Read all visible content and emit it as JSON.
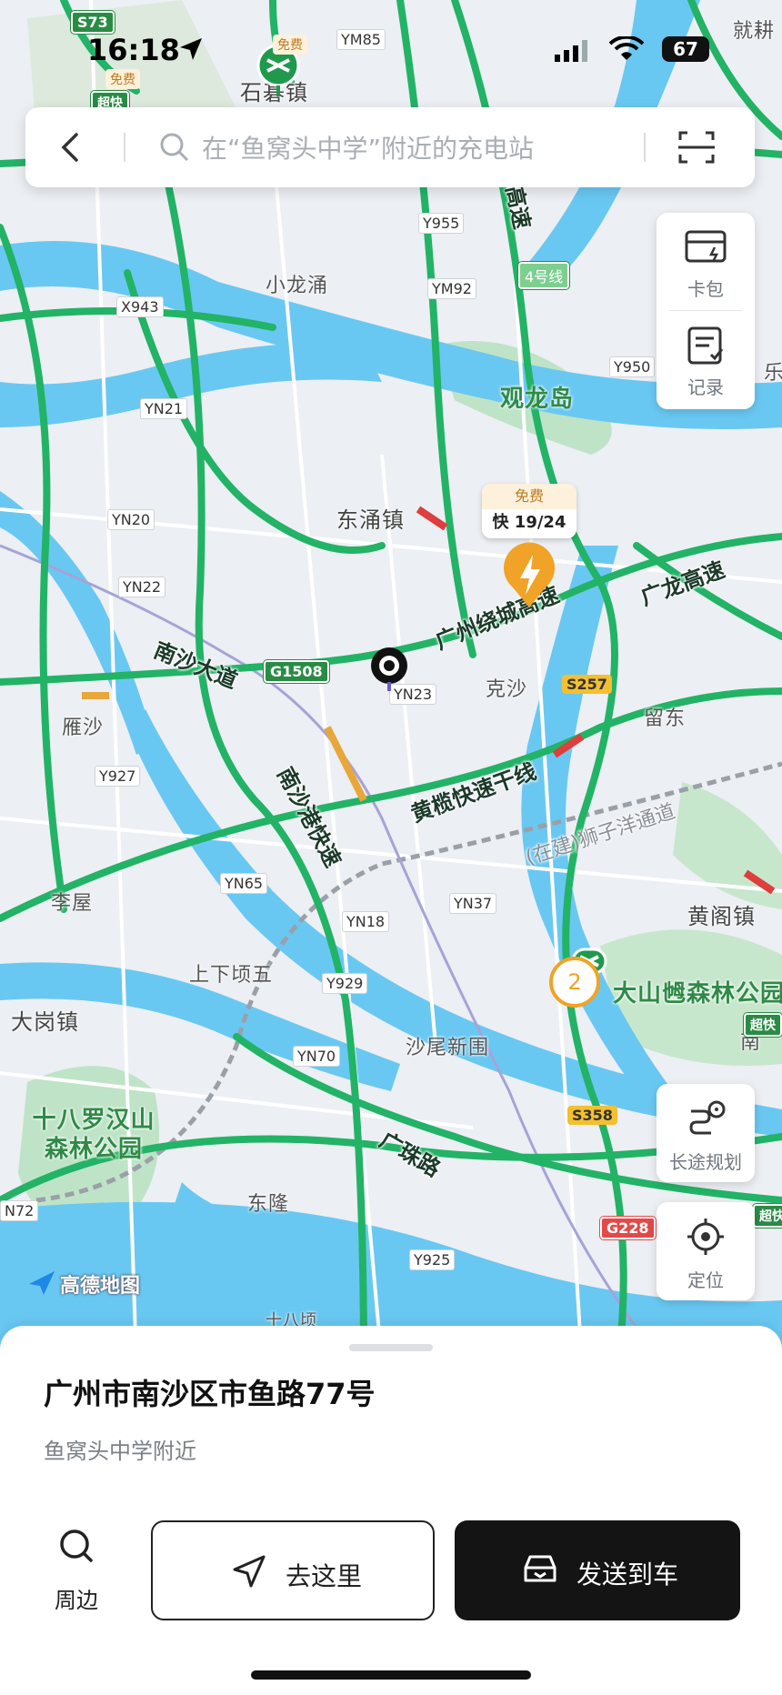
{
  "status_bar": {
    "time": "16:18",
    "battery": "67"
  },
  "search": {
    "placeholder": "在“鱼窝头中学”附近的充电站"
  },
  "side_panel": {
    "wallet_label": "卡包",
    "records_label": "记录"
  },
  "map": {
    "places": [
      "石碁镇",
      "小龙涌",
      "观龙岛",
      "东涌镇",
      "克沙",
      "留东",
      "雁沙",
      "李屋",
      "上下顷五",
      "黄阁镇",
      "大山乸森林公园",
      "大岗镇",
      "沙尾新围",
      "十八罗汉山森林公园",
      "东隆",
      "就耕",
      "乐",
      "南",
      "十八顷"
    ],
    "road_numbers": [
      "YM85",
      "Y955",
      "YM92",
      "X943",
      "Y950",
      "YN21",
      "YN20",
      "YN22",
      "YN23",
      "Y927",
      "YN65",
      "YN37",
      "YN18",
      "Y929",
      "YN70",
      "Y925",
      "N72"
    ],
    "shields": {
      "s73": "S73",
      "g1508": "G1508",
      "s257": "S257",
      "s358": "S358",
      "g228": "G228"
    },
    "road_names": {
      "nansha_ave": "南沙大道",
      "guangzhou_ring": "广州绕城高速",
      "guanglong": "广龙高速",
      "huanglan": "黄榄快速干线",
      "nanshagang": "南沙港快速",
      "shiziyang": "(在建)狮子洋通道",
      "guangzhu": "广珠路",
      "gaosu_vert": "高速"
    },
    "metro_line": "4号线",
    "free_tag": "免费",
    "superfast_tag": "超快",
    "charging_station": {
      "free": "免费",
      "fast": "快",
      "availability": "19/24"
    },
    "cluster_count": "2",
    "logo_text": "高德地图"
  },
  "float_buttons": {
    "long_trip": "长途规划",
    "locate": "定位"
  },
  "sheet": {
    "address": "广州市南沙区市鱼路77号",
    "nearby_text": "鱼窝头中学附近",
    "nearby_button": "周边",
    "go_button": "去这里",
    "send_button": "发送到车"
  },
  "colors": {
    "road_green": "#22b366",
    "water": "#69c8f2",
    "park": "#bfe3c7",
    "charger": "#f0a326"
  }
}
